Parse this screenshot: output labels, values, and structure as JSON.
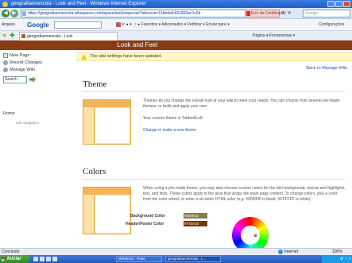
{
  "browser": {
    "window_title": "geografiaemescola - Look and Feel - Windows Internet Explorer",
    "url": "https://geografiaemescola.wikispaces.com/space/look/response?observe=11bbdafc661893ac1c6b",
    "cert_error": "Erro de Certificado",
    "search_placeholder": "Google",
    "tab_title": "geografiaemescola - Look",
    "menu_arquivo": "Arquivo",
    "google_label": "Google",
    "toolbar_items": "Ir ◂ ✦ ☆ ▸ Favoritos ▾   Adicionados ▾   Verificar ▾   Enviar para ▾",
    "toolbar_config": "Configurações",
    "command_bar": "Página ▾   Ferramentas ▾"
  },
  "page": {
    "header_title": "Look and Feel",
    "sidebar": {
      "new_page": "New Page",
      "recent_changes": "Recent Changes",
      "manage_wiki": "Manage Wiki",
      "search_value": "Search",
      "home": "Home",
      "add_navigation": "edit navigation"
    },
    "notice": "The wiki settings have been updated.",
    "back_link": "Back to Manage Wiki",
    "theme": {
      "title": "Theme",
      "description": "Themes let you change the overall look of your wiki to meet your needs. You can choose from several pre-made themes, or build and apply your own.",
      "current": "Your current theme is Tabbed/Left",
      "change_link": "Change or make a new theme"
    },
    "colors": {
      "title": "Colors",
      "description": "When using a pre-made theme, you may also choose custom colors for the wiki background, menus and highlights, text, and links. These colors apply to the area that wraps the main page content. To change colors, pick a color from the color wheel, or enter a six-letter HTML color (e.g. #000000 is black, #FFFFFF is white).",
      "bg_label": "Background Color",
      "bg_value": "#e6e5cd",
      "header_label": "Header/Footer Color",
      "header_value": "#773A10"
    }
  },
  "status": {
    "done": "Concluído",
    "zone": "Internet",
    "zoom": "100%"
  },
  "taskbar": {
    "start": "Iniciar",
    "btn1": "WIKIESO - Paint",
    "btn2": "geografiaemescola - L...",
    "tray_time": "⚙ ◔ ◑"
  },
  "colors": {
    "header": "#8b3b14",
    "link": "#2a4fb3"
  }
}
